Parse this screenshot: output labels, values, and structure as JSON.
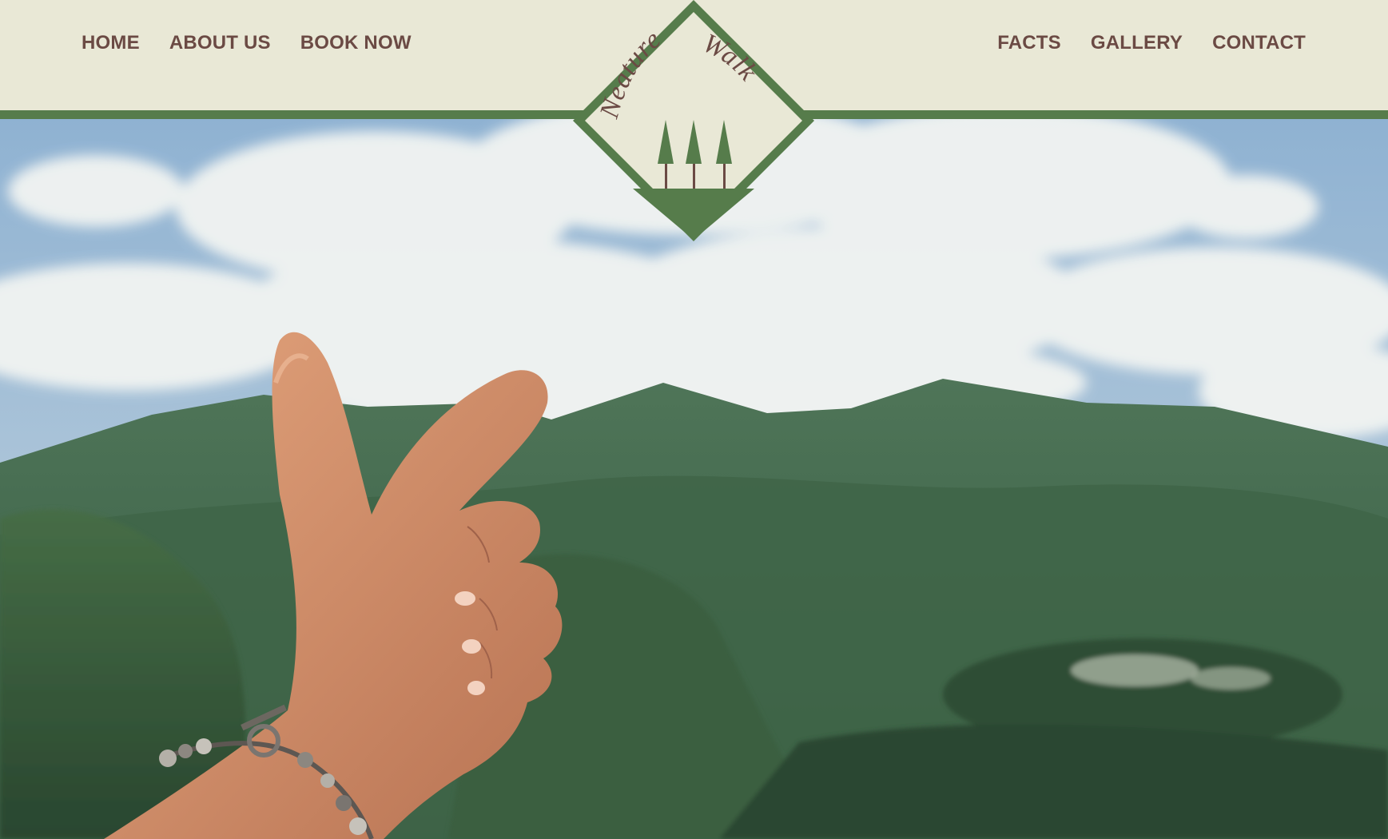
{
  "site": {
    "logo_text": "Neature Walk"
  },
  "nav": {
    "left": [
      {
        "label": "HOME"
      },
      {
        "label": "ABOUT US"
      },
      {
        "label": "BOOK NOW"
      }
    ],
    "right": [
      {
        "label": "FACTS"
      },
      {
        "label": "GALLERY"
      },
      {
        "label": "CONTACT"
      }
    ]
  },
  "colors": {
    "header_bg": "#e9e8d6",
    "accent_green": "#567c4b",
    "nav_text": "#6b4a44",
    "tree_trunk": "#6b4a44"
  },
  "hero": {
    "image_subject": "hand-pointing-at-mountains-photo"
  }
}
